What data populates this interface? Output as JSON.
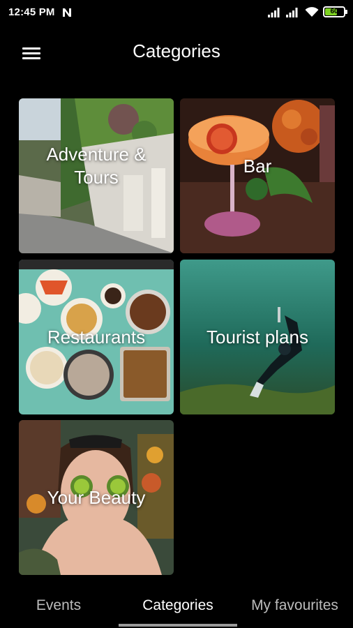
{
  "status_bar": {
    "time": "12:45 PM",
    "battery_level": "60",
    "battery_color": "#7ed321"
  },
  "header": {
    "title": "Categories",
    "menu_icon": "hamburger-menu-icon"
  },
  "categories": [
    {
      "label": "Adventure & Tours"
    },
    {
      "label": "Bar"
    },
    {
      "label": "Restaurants"
    },
    {
      "label": "Tourist plans"
    },
    {
      "label": "Your Beauty"
    }
  ],
  "bottom_nav": {
    "tabs": [
      {
        "label": "Events",
        "active": false
      },
      {
        "label": "Categories",
        "active": true
      },
      {
        "label": "My favourites",
        "active": false
      }
    ]
  }
}
